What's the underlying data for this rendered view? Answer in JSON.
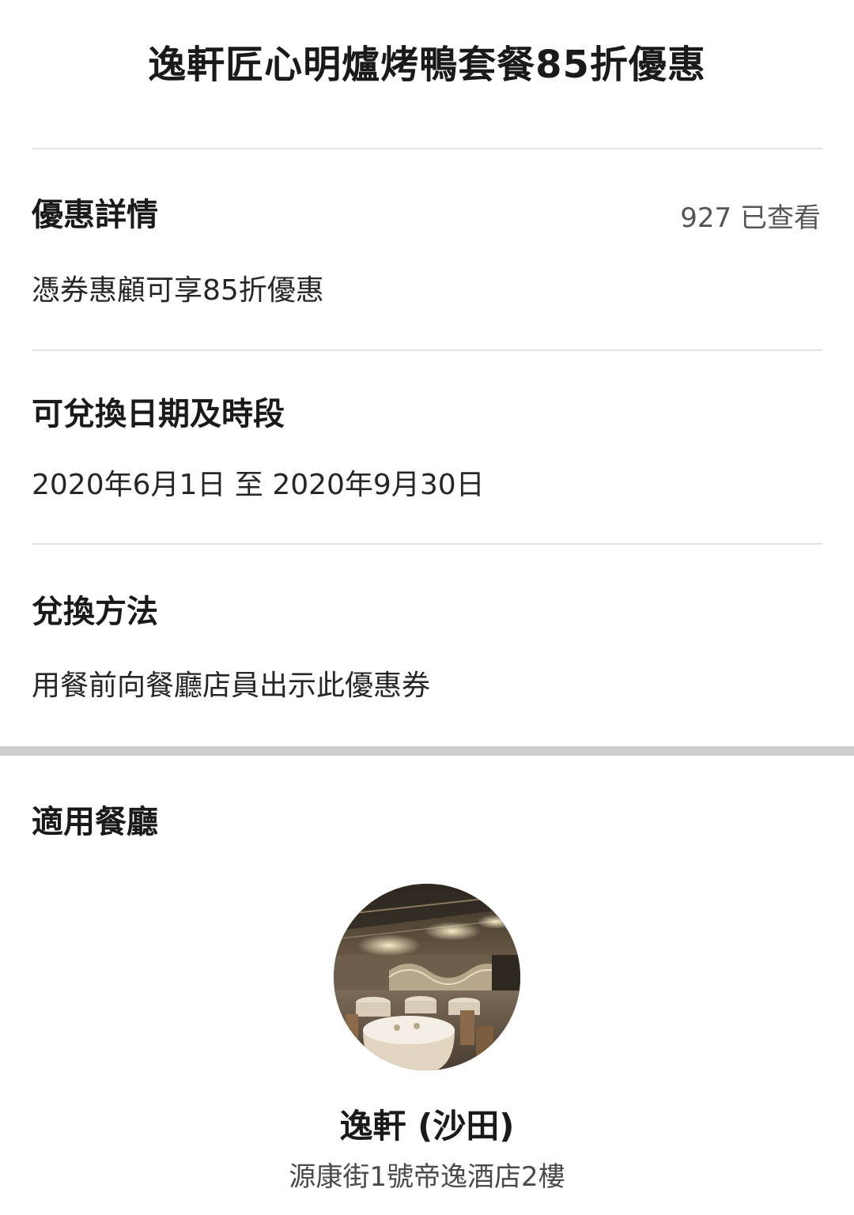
{
  "offer": {
    "title": "逸軒匠心明爐烤鴨套餐85折優惠"
  },
  "details": {
    "heading": "優惠詳情",
    "views": "927 已查看",
    "body": "憑券惠顧可享85折優惠"
  },
  "period": {
    "heading": "可兌換日期及時段",
    "body": "2020年6月1日 至 2020年9月30日"
  },
  "redemption": {
    "heading": "兌換方法",
    "body": "用餐前向餐廳店員出示此優惠券"
  },
  "restaurants": {
    "heading": "適用餐廳",
    "items": [
      {
        "name": "逸軒 (沙田)",
        "address": "源康街1號帝逸酒店2樓"
      }
    ]
  }
}
